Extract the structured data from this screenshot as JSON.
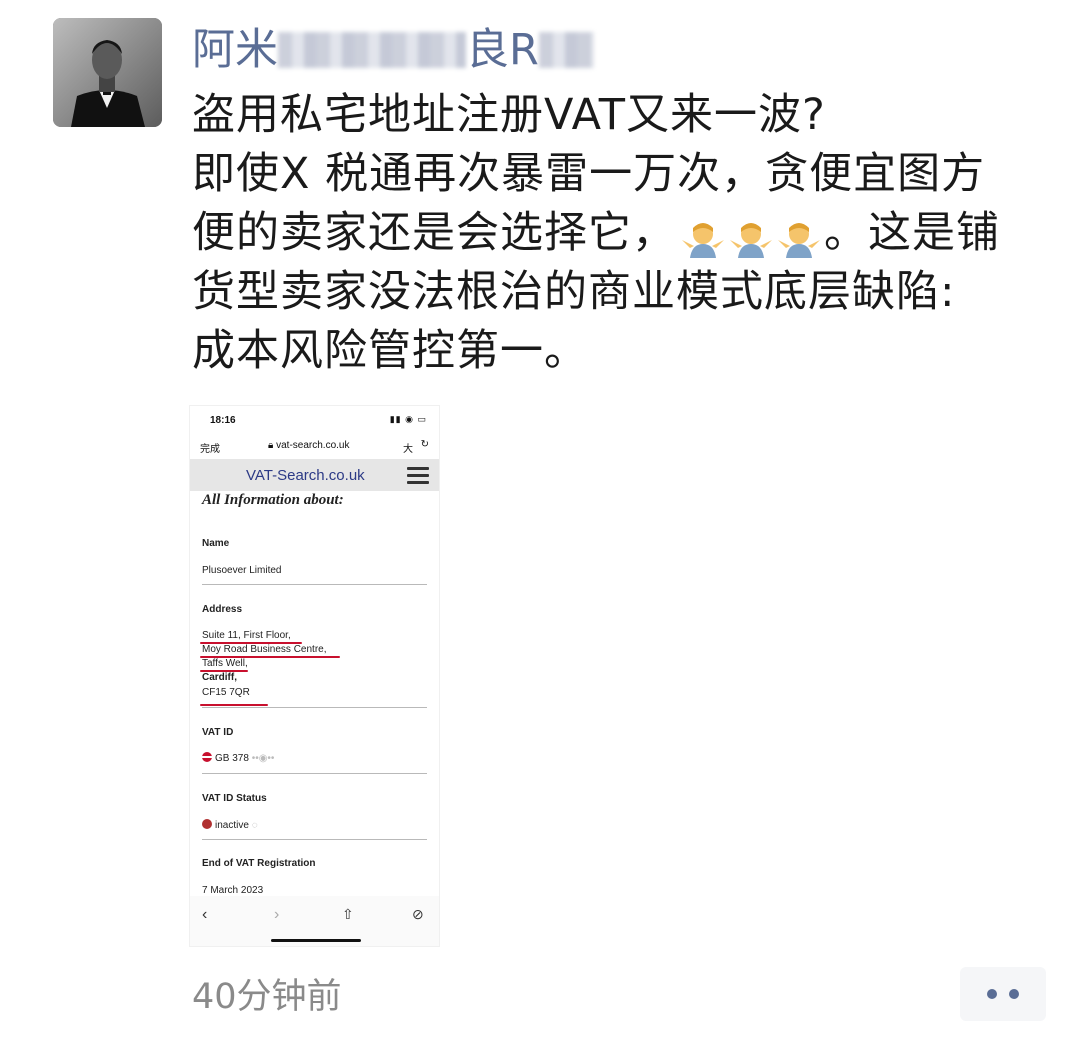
{
  "post": {
    "author": {
      "name_visible_start": "阿米",
      "name_visible_mid": "良R",
      "name_masked": true
    },
    "text_lines": [
      "盗用私宅地址注册VAT又来一波?",
      "即使X 税通再次暴雷一万次，贪便宜图方",
      "便的卖家还是会选择它，",
      "。这是铺",
      "货型卖家没法根治的商业模式底层缺陷:",
      "成本风险管控第一。"
    ],
    "emoji": [
      "person-shrugging-emoji",
      "person-shrugging-emoji",
      "person-shrugging-emoji"
    ],
    "time_ago": "40分钟前",
    "more_button_icon": "more-dots-icon"
  },
  "screenshot": {
    "status_time": "18:16",
    "done_label": "完成",
    "url": "vat-search.co.uk",
    "text_size_label": "大",
    "site_title": "VAT-Search.co.uk",
    "heading": "All Information about:",
    "fields": {
      "name_label": "Name",
      "name_value": "Plusoever Limited",
      "address_label": "Address",
      "address_lines": [
        "Suite 11, First Floor,",
        "Moy Road Business Centre,",
        "Taffs Well,",
        "Cardiff,",
        "CF15 7QR"
      ],
      "vat_id_label": "VAT ID",
      "vat_id_value": "GB 378",
      "vat_status_label": "VAT ID Status",
      "vat_status_value": "inactive",
      "end_label": "End of VAT Registration",
      "end_value": "7 March 2023"
    },
    "toolbar": [
      "back-icon",
      "forward-icon",
      "share-icon",
      "compass-icon"
    ]
  },
  "colors": {
    "author_blue": "#5a6d95",
    "annotation_red": "#c8102e",
    "muted_gray": "#8a8a8a"
  }
}
